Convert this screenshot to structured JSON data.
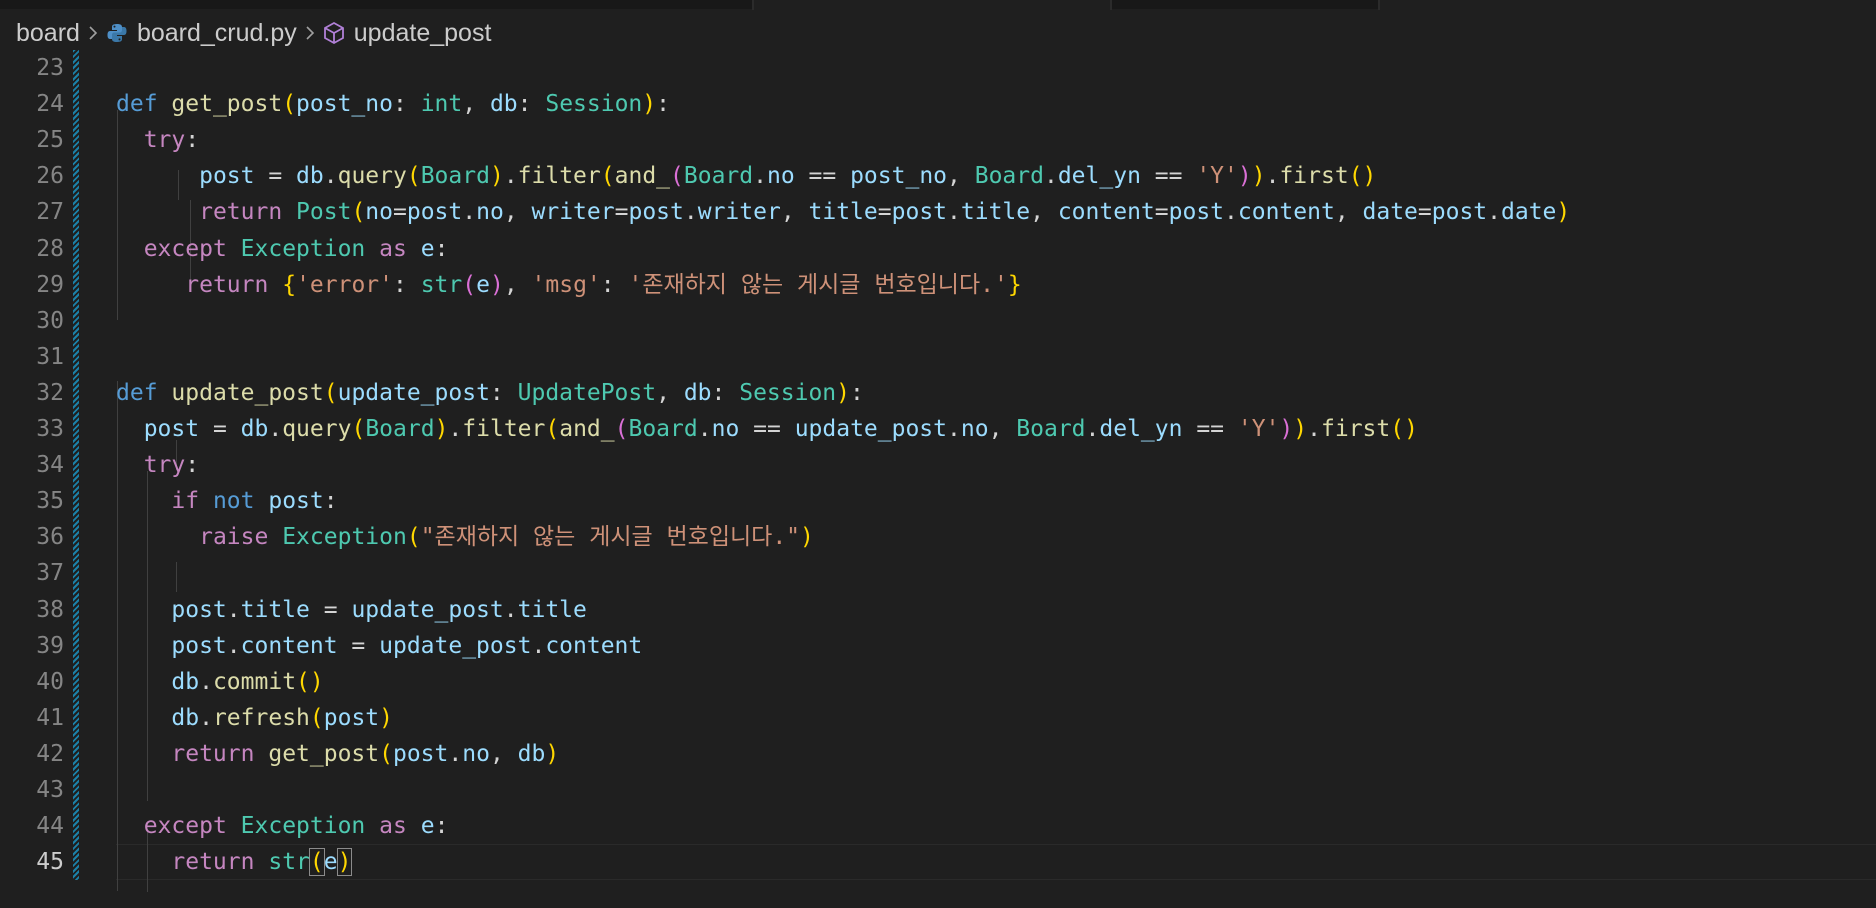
{
  "breadcrumb": {
    "folder": "board",
    "file": "board_crud.py",
    "symbol": "update_post"
  },
  "icons": {
    "separator": "chevron-right-icon",
    "file": "python-file-icon",
    "symbol": "symbol-method-icon"
  },
  "colors": {
    "background": "#1f1f1f",
    "keyword": "#569cd6",
    "control": "#c586c0",
    "function": "#dcdcaa",
    "variable": "#9cdcfe",
    "type": "#4ec9b0",
    "string": "#ce9178",
    "bracket_level1": "#ffd700",
    "bracket_level2": "#da70d6",
    "modified_gutter": "#1b81a8"
  },
  "editor": {
    "active_line": "45",
    "lines": [
      {
        "n": "23",
        "tokens": []
      },
      {
        "n": "24",
        "tokens": [
          {
            "c": "k",
            "t": "def"
          },
          {
            "c": "",
            "t": " "
          },
          {
            "c": "f",
            "t": "get_post"
          },
          {
            "c": "p1",
            "t": "("
          },
          {
            "c": "v",
            "t": "post_no"
          },
          {
            "c": "",
            "t": ": "
          },
          {
            "c": "t",
            "t": "int"
          },
          {
            "c": "",
            "t": ", "
          },
          {
            "c": "v",
            "t": "db"
          },
          {
            "c": "",
            "t": ": "
          },
          {
            "c": "t",
            "t": "Session"
          },
          {
            "c": "p1",
            "t": ")"
          },
          {
            "c": "",
            "t": ":"
          }
        ]
      },
      {
        "n": "25",
        "tokens": [
          {
            "c": "",
            "t": "  "
          },
          {
            "c": "kc",
            "t": "try"
          },
          {
            "c": "",
            "t": ":"
          }
        ]
      },
      {
        "n": "26",
        "tokens": [
          {
            "c": "",
            "t": "      "
          },
          {
            "c": "v",
            "t": "post"
          },
          {
            "c": "",
            "t": " = "
          },
          {
            "c": "v",
            "t": "db"
          },
          {
            "c": "",
            "t": "."
          },
          {
            "c": "f",
            "t": "query"
          },
          {
            "c": "p1",
            "t": "("
          },
          {
            "c": "t",
            "t": "Board"
          },
          {
            "c": "p1",
            "t": ")"
          },
          {
            "c": "",
            "t": "."
          },
          {
            "c": "f",
            "t": "filter"
          },
          {
            "c": "p1",
            "t": "("
          },
          {
            "c": "f",
            "t": "and_"
          },
          {
            "c": "p2",
            "t": "("
          },
          {
            "c": "t",
            "t": "Board"
          },
          {
            "c": "",
            "t": "."
          },
          {
            "c": "v",
            "t": "no"
          },
          {
            "c": "",
            "t": " == "
          },
          {
            "c": "v",
            "t": "post_no"
          },
          {
            "c": "",
            "t": ", "
          },
          {
            "c": "t",
            "t": "Board"
          },
          {
            "c": "",
            "t": "."
          },
          {
            "c": "v",
            "t": "del_yn"
          },
          {
            "c": "",
            "t": " == "
          },
          {
            "c": "s",
            "t": "'Y'"
          },
          {
            "c": "p2",
            "t": ")"
          },
          {
            "c": "p1",
            "t": ")"
          },
          {
            "c": "",
            "t": "."
          },
          {
            "c": "f",
            "t": "first"
          },
          {
            "c": "p1",
            "t": "()"
          }
        ]
      },
      {
        "n": "27",
        "tokens": [
          {
            "c": "",
            "t": "      "
          },
          {
            "c": "kc",
            "t": "return"
          },
          {
            "c": "",
            "t": " "
          },
          {
            "c": "t",
            "t": "Post"
          },
          {
            "c": "p1",
            "t": "("
          },
          {
            "c": "v",
            "t": "no"
          },
          {
            "c": "",
            "t": "="
          },
          {
            "c": "v",
            "t": "post"
          },
          {
            "c": "",
            "t": "."
          },
          {
            "c": "v",
            "t": "no"
          },
          {
            "c": "",
            "t": ", "
          },
          {
            "c": "v",
            "t": "writer"
          },
          {
            "c": "",
            "t": "="
          },
          {
            "c": "v",
            "t": "post"
          },
          {
            "c": "",
            "t": "."
          },
          {
            "c": "v",
            "t": "writer"
          },
          {
            "c": "",
            "t": ", "
          },
          {
            "c": "v",
            "t": "title"
          },
          {
            "c": "",
            "t": "="
          },
          {
            "c": "v",
            "t": "post"
          },
          {
            "c": "",
            "t": "."
          },
          {
            "c": "v",
            "t": "title"
          },
          {
            "c": "",
            "t": ", "
          },
          {
            "c": "v",
            "t": "content"
          },
          {
            "c": "",
            "t": "="
          },
          {
            "c": "v",
            "t": "post"
          },
          {
            "c": "",
            "t": "."
          },
          {
            "c": "v",
            "t": "content"
          },
          {
            "c": "",
            "t": ", "
          },
          {
            "c": "v",
            "t": "date"
          },
          {
            "c": "",
            "t": "="
          },
          {
            "c": "v",
            "t": "post"
          },
          {
            "c": "",
            "t": "."
          },
          {
            "c": "v",
            "t": "date"
          },
          {
            "c": "p1",
            "t": ")"
          }
        ]
      },
      {
        "n": "28",
        "tokens": [
          {
            "c": "",
            "t": "  "
          },
          {
            "c": "kc",
            "t": "except"
          },
          {
            "c": "",
            "t": " "
          },
          {
            "c": "t",
            "t": "Exception"
          },
          {
            "c": "",
            "t": " "
          },
          {
            "c": "kc",
            "t": "as"
          },
          {
            "c": "",
            "t": " "
          },
          {
            "c": "v",
            "t": "e"
          },
          {
            "c": "",
            "t": ":"
          }
        ]
      },
      {
        "n": "29",
        "tokens": [
          {
            "c": "",
            "t": "     "
          },
          {
            "c": "kc",
            "t": "return"
          },
          {
            "c": "",
            "t": " "
          },
          {
            "c": "p1",
            "t": "{"
          },
          {
            "c": "s",
            "t": "'error'"
          },
          {
            "c": "",
            "t": ": "
          },
          {
            "c": "t",
            "t": "str"
          },
          {
            "c": "p2",
            "t": "("
          },
          {
            "c": "v",
            "t": "e"
          },
          {
            "c": "p2",
            "t": ")"
          },
          {
            "c": "",
            "t": ", "
          },
          {
            "c": "s",
            "t": "'msg'"
          },
          {
            "c": "",
            "t": ": "
          },
          {
            "c": "s",
            "t": "'존재하지 않는 게시글 번호입니다.'"
          },
          {
            "c": "p1",
            "t": "}"
          }
        ]
      },
      {
        "n": "30",
        "tokens": []
      },
      {
        "n": "31",
        "tokens": []
      },
      {
        "n": "32",
        "tokens": [
          {
            "c": "k",
            "t": "def"
          },
          {
            "c": "",
            "t": " "
          },
          {
            "c": "f",
            "t": "update_post"
          },
          {
            "c": "p1",
            "t": "("
          },
          {
            "c": "v",
            "t": "update_post"
          },
          {
            "c": "",
            "t": ": "
          },
          {
            "c": "t",
            "t": "UpdatePost"
          },
          {
            "c": "",
            "t": ", "
          },
          {
            "c": "v",
            "t": "db"
          },
          {
            "c": "",
            "t": ": "
          },
          {
            "c": "t",
            "t": "Session"
          },
          {
            "c": "p1",
            "t": ")"
          },
          {
            "c": "",
            "t": ":"
          }
        ]
      },
      {
        "n": "33",
        "tokens": [
          {
            "c": "",
            "t": "  "
          },
          {
            "c": "v",
            "t": "post"
          },
          {
            "c": "",
            "t": " = "
          },
          {
            "c": "v",
            "t": "db"
          },
          {
            "c": "",
            "t": "."
          },
          {
            "c": "f",
            "t": "query"
          },
          {
            "c": "p1",
            "t": "("
          },
          {
            "c": "t",
            "t": "Board"
          },
          {
            "c": "p1",
            "t": ")"
          },
          {
            "c": "",
            "t": "."
          },
          {
            "c": "f",
            "t": "filter"
          },
          {
            "c": "p1",
            "t": "("
          },
          {
            "c": "f",
            "t": "and_"
          },
          {
            "c": "p2",
            "t": "("
          },
          {
            "c": "t",
            "t": "Board"
          },
          {
            "c": "",
            "t": "."
          },
          {
            "c": "v",
            "t": "no"
          },
          {
            "c": "",
            "t": " == "
          },
          {
            "c": "v",
            "t": "update_post"
          },
          {
            "c": "",
            "t": "."
          },
          {
            "c": "v",
            "t": "no"
          },
          {
            "c": "",
            "t": ", "
          },
          {
            "c": "t",
            "t": "Board"
          },
          {
            "c": "",
            "t": "."
          },
          {
            "c": "v",
            "t": "del_yn"
          },
          {
            "c": "",
            "t": " == "
          },
          {
            "c": "s",
            "t": "'Y'"
          },
          {
            "c": "p2",
            "t": ")"
          },
          {
            "c": "p1",
            "t": ")"
          },
          {
            "c": "",
            "t": "."
          },
          {
            "c": "f",
            "t": "first"
          },
          {
            "c": "p1",
            "t": "()"
          }
        ]
      },
      {
        "n": "34",
        "tokens": [
          {
            "c": "",
            "t": "  "
          },
          {
            "c": "kc",
            "t": "try"
          },
          {
            "c": "",
            "t": ":"
          }
        ]
      },
      {
        "n": "35",
        "tokens": [
          {
            "c": "",
            "t": "    "
          },
          {
            "c": "kc",
            "t": "if"
          },
          {
            "c": "",
            "t": " "
          },
          {
            "c": "k",
            "t": "not"
          },
          {
            "c": "",
            "t": " "
          },
          {
            "c": "v",
            "t": "post"
          },
          {
            "c": "",
            "t": ":"
          }
        ]
      },
      {
        "n": "36",
        "tokens": [
          {
            "c": "",
            "t": "      "
          },
          {
            "c": "kc",
            "t": "raise"
          },
          {
            "c": "",
            "t": " "
          },
          {
            "c": "t",
            "t": "Exception"
          },
          {
            "c": "p1",
            "t": "("
          },
          {
            "c": "s",
            "t": "\"존재하지 않는 게시글 번호입니다.\""
          },
          {
            "c": "p1",
            "t": ")"
          }
        ]
      },
      {
        "n": "37",
        "tokens": []
      },
      {
        "n": "38",
        "tokens": [
          {
            "c": "",
            "t": "    "
          },
          {
            "c": "v",
            "t": "post"
          },
          {
            "c": "",
            "t": "."
          },
          {
            "c": "v",
            "t": "title"
          },
          {
            "c": "",
            "t": " = "
          },
          {
            "c": "v",
            "t": "update_post"
          },
          {
            "c": "",
            "t": "."
          },
          {
            "c": "v",
            "t": "title"
          }
        ]
      },
      {
        "n": "39",
        "tokens": [
          {
            "c": "",
            "t": "    "
          },
          {
            "c": "v",
            "t": "post"
          },
          {
            "c": "",
            "t": "."
          },
          {
            "c": "v",
            "t": "content"
          },
          {
            "c": "",
            "t": " = "
          },
          {
            "c": "v",
            "t": "update_post"
          },
          {
            "c": "",
            "t": "."
          },
          {
            "c": "v",
            "t": "content"
          }
        ]
      },
      {
        "n": "40",
        "tokens": [
          {
            "c": "",
            "t": "    "
          },
          {
            "c": "v",
            "t": "db"
          },
          {
            "c": "",
            "t": "."
          },
          {
            "c": "f",
            "t": "commit"
          },
          {
            "c": "p1",
            "t": "()"
          }
        ]
      },
      {
        "n": "41",
        "tokens": [
          {
            "c": "",
            "t": "    "
          },
          {
            "c": "v",
            "t": "db"
          },
          {
            "c": "",
            "t": "."
          },
          {
            "c": "f",
            "t": "refresh"
          },
          {
            "c": "p1",
            "t": "("
          },
          {
            "c": "v",
            "t": "post"
          },
          {
            "c": "p1",
            "t": ")"
          }
        ]
      },
      {
        "n": "42",
        "tokens": [
          {
            "c": "",
            "t": "    "
          },
          {
            "c": "kc",
            "t": "return"
          },
          {
            "c": "",
            "t": " "
          },
          {
            "c": "f",
            "t": "get_post"
          },
          {
            "c": "p1",
            "t": "("
          },
          {
            "c": "v",
            "t": "post"
          },
          {
            "c": "",
            "t": "."
          },
          {
            "c": "v",
            "t": "no"
          },
          {
            "c": "",
            "t": ", "
          },
          {
            "c": "v",
            "t": "db"
          },
          {
            "c": "p1",
            "t": ")"
          }
        ]
      },
      {
        "n": "43",
        "tokens": []
      },
      {
        "n": "44",
        "tokens": [
          {
            "c": "",
            "t": "  "
          },
          {
            "c": "kc",
            "t": "except"
          },
          {
            "c": "",
            "t": " "
          },
          {
            "c": "t",
            "t": "Exception"
          },
          {
            "c": "",
            "t": " "
          },
          {
            "c": "kc",
            "t": "as"
          },
          {
            "c": "",
            "t": " "
          },
          {
            "c": "v",
            "t": "e"
          },
          {
            "c": "",
            "t": ":"
          }
        ]
      },
      {
        "n": "45",
        "tokens": [
          {
            "c": "",
            "t": "    "
          },
          {
            "c": "kc",
            "t": "return"
          },
          {
            "c": "",
            "t": " "
          },
          {
            "c": "t",
            "t": "str"
          },
          {
            "c": "p1 bm",
            "t": "("
          },
          {
            "c": "v",
            "t": "e"
          },
          {
            "c": "p1 bm",
            "t": ")"
          }
        ]
      }
    ]
  }
}
